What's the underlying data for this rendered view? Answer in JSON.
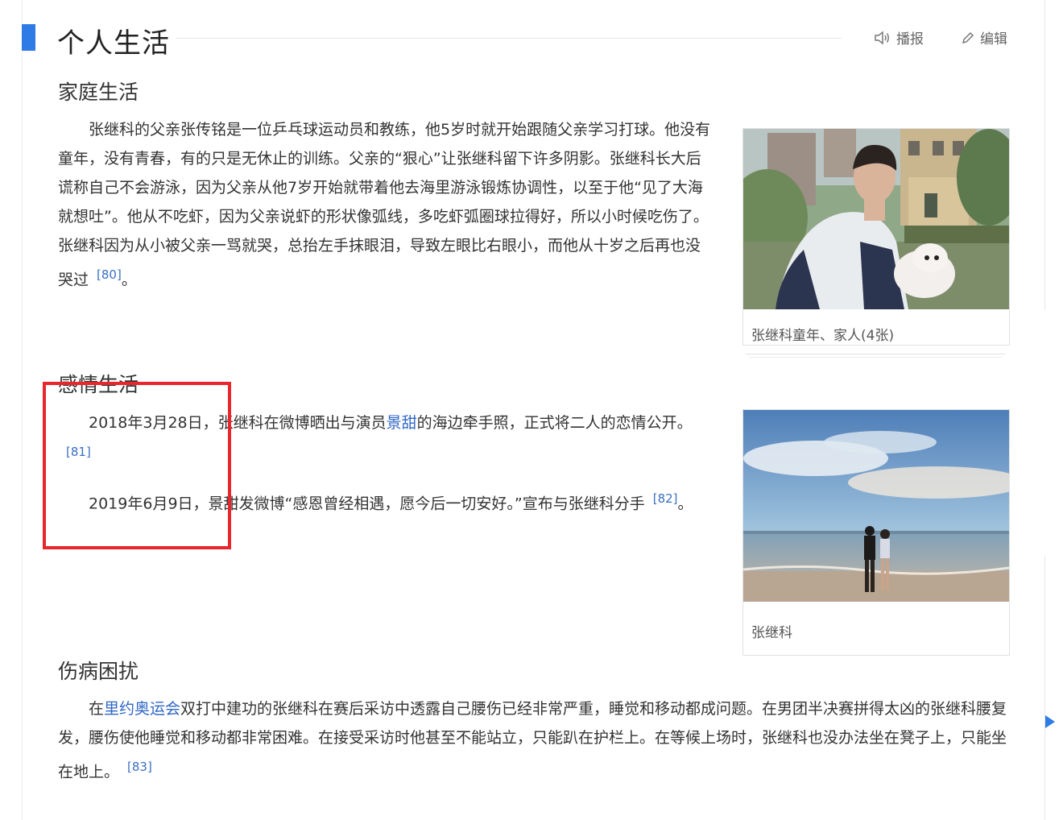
{
  "section": {
    "title": "个人生活",
    "actions": {
      "report_label": "播报",
      "edit_label": "编辑"
    }
  },
  "family": {
    "title": "家庭生活",
    "text": "张继科的父亲张传铭是一位乒乓球运动员和教练，他5岁时就开始跟随父亲学习打球。他没有童年，没有青春，有的只是无休止的训练。父亲的“狠心”让张继科留下许多阴影。张继科长大后谎称自己不会游泳，因为父亲从他7岁开始就带着他去海里游泳锻炼协调性，以至于他“见了大海就想吐”。他从不吃虾，因为父亲说虾的形状像弧线，多吃虾弧圈球拉得好，所以小时候吃伤了。张继科因为从小被父亲一骂就哭，总抬左手抹眼泪，导致左眼比右眼小，而他从十岁之后再也没哭过",
    "ref": "[80]",
    "end": "。"
  },
  "romance": {
    "title": "感情生活",
    "p1_date": "2018年3月28日，",
    "p1_before": "张继科在微博晒出与演员",
    "p1_link": "景甜",
    "p1_after": "的海边牵手照，正式将二人的恋情公开。",
    "p1_ref": "[81]",
    "p2_date": "2019年6月9日，",
    "p2_text": "景甜发微博“感恩曾经相遇，愿今后一切安好。”宣布与张继科分手",
    "p2_ref": "[82]",
    "p2_end": "。"
  },
  "injury": {
    "title": "伤病困扰",
    "pre": "在",
    "link": "里约奥运会",
    "text": "双打中建功的张继科在赛后采访中透露自己腰伤已经非常严重，睡觉和移动都成问题。在男团半决赛拼得太凶的张继科腰复发，腰伤使他睡觉和移动都非常困难。在接受采访时他甚至不能站立，只能趴在护栏上。在等候上场时，张继科也没办法坐在凳子上，只能坐在地上。",
    "ref": "[83]"
  },
  "figures": [
    {
      "caption": "张继科童年、家人(4张)"
    },
    {
      "caption": "张继科"
    }
  ],
  "colors": {
    "accent": "#2f7be6",
    "link": "#2f66c5",
    "highlight_box": "#e8262c"
  }
}
